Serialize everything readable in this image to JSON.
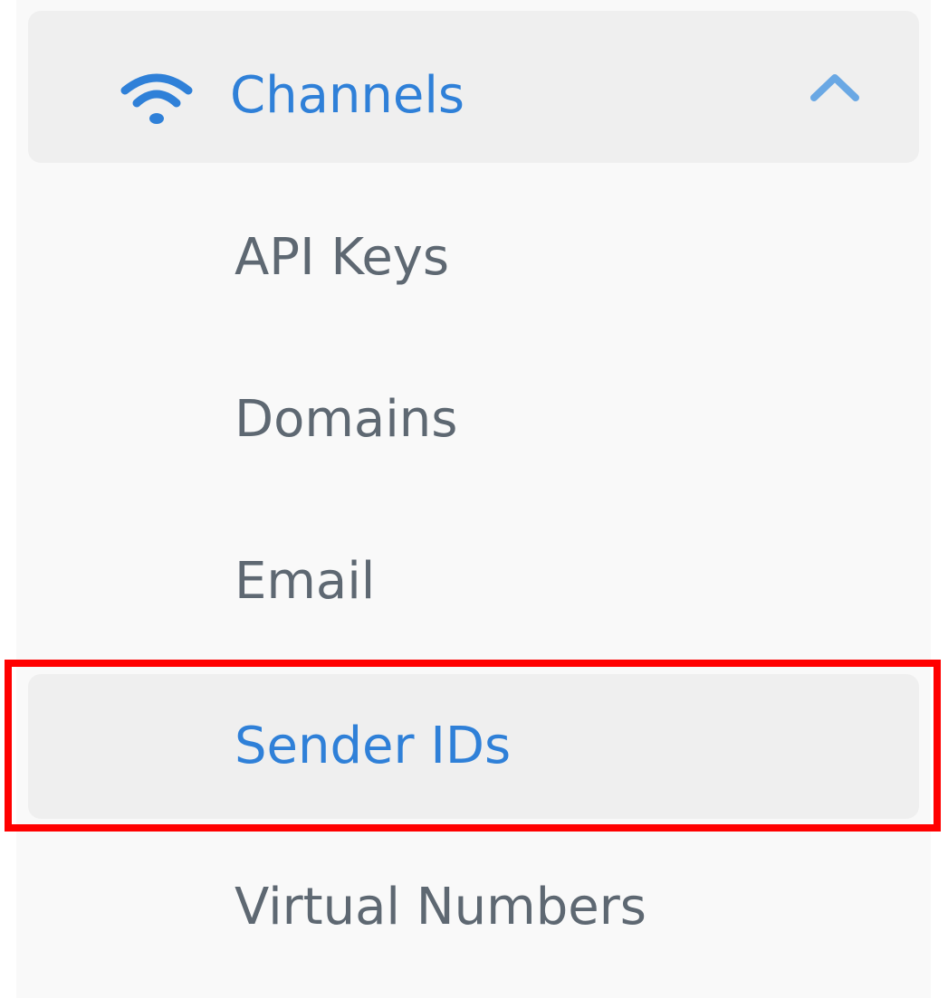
{
  "sidebar": {
    "section": {
      "label": "Channels",
      "icon": "wifi-icon",
      "toggle_icon": "chevron-up-icon",
      "expanded": true,
      "accent_color": "#2f80d8"
    },
    "items": [
      {
        "label": "API Keys",
        "active": false
      },
      {
        "label": "Domains",
        "active": false
      },
      {
        "label": "Email",
        "active": false
      },
      {
        "label": "Sender IDs",
        "active": true
      },
      {
        "label": "Virtual Numbers",
        "active": false
      }
    ],
    "colors": {
      "background": "#f9f9f9",
      "active_background": "#efefef",
      "item_text": "#5e6872",
      "active_text": "#2f80d8",
      "highlight": "#ff0000"
    }
  }
}
